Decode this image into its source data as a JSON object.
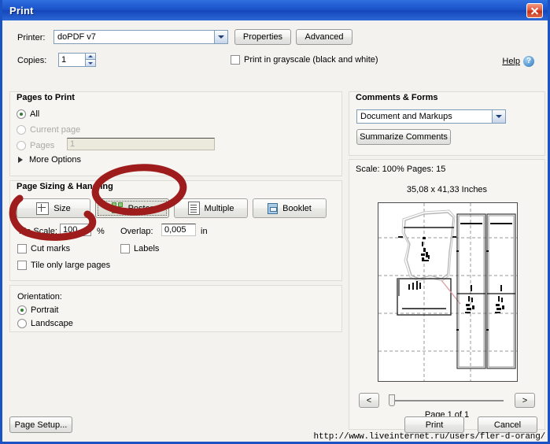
{
  "window": {
    "title": "Print",
    "close_icon": "close-icon"
  },
  "printer": {
    "label": "Printer:",
    "value": "doPDF v7",
    "properties_label": "Properties",
    "advanced_label": "Advanced",
    "copies_label": "Copies:",
    "copies_value": "1",
    "grayscale_label": "Print in grayscale (black and white)",
    "grayscale_checked": false,
    "help_label": "Help",
    "help_icon": "help-circle-icon"
  },
  "pages_to_print": {
    "title": "Pages to Print",
    "options": [
      {
        "label": "All",
        "selected": true,
        "enabled": true
      },
      {
        "label": "Current page",
        "selected": false,
        "enabled": false
      },
      {
        "label": "Pages",
        "selected": false,
        "enabled": false
      }
    ],
    "pages_value": "1",
    "more_options_label": "More Options",
    "more_options_icon": "triangle-right-icon"
  },
  "page_sizing": {
    "title": "Page Sizing & Handling",
    "buttons": [
      {
        "label": "Size",
        "icon": "size-icon",
        "active": false
      },
      {
        "label": "Poster",
        "icon": "poster-icon",
        "active": true
      },
      {
        "label": "Multiple",
        "icon": "multiple-icon",
        "active": false
      },
      {
        "label": "Booklet",
        "icon": "booklet-icon",
        "active": false
      }
    ],
    "tile_scale_label": "Tile Scale:",
    "tile_scale_value": "100",
    "tile_scale_unit": "%",
    "overlap_label": "Overlap:",
    "overlap_value": "0,005",
    "overlap_unit": "in",
    "cut_marks_label": "Cut marks",
    "cut_marks_checked": false,
    "labels_label": "Labels",
    "labels_checked": false,
    "tile_only_large_label": "Tile only large pages",
    "tile_only_large_checked": false
  },
  "orientation": {
    "label": "Orientation:",
    "options": [
      {
        "label": "Portrait",
        "selected": true
      },
      {
        "label": "Landscape",
        "selected": false
      }
    ]
  },
  "comments_forms": {
    "title": "Comments & Forms",
    "selected": "Document and Markups",
    "summarize_label": "Summarize Comments"
  },
  "preview": {
    "scale_line": "Scale: 100% Pages: 15",
    "dimensions": "35,08 x 41,33 Inches",
    "prev_label": "<",
    "next_label": ">",
    "page_indicator": "Page 1 of 1"
  },
  "footer": {
    "page_setup_label": "Page Setup...",
    "print_label": "Print",
    "cancel_label": "Cancel",
    "watermark": "http://www.liveinternet.ru/users/fler-d-orang/"
  },
  "annotations": {
    "color": "#9e1c1c",
    "marks": [
      {
        "name": "poster-circle",
        "shape": "ellipse"
      },
      {
        "name": "tile-scale-hook",
        "shape": "u-curve"
      }
    ]
  },
  "colors": {
    "titlebar": "#1a52c8",
    "window_border": "#1b52c4",
    "dialog_bg": "#f3f2ee",
    "group_bg": "#f6f5f1",
    "annotation_red": "#9e1c1c",
    "radio_dot_green": "#2f7d32"
  }
}
